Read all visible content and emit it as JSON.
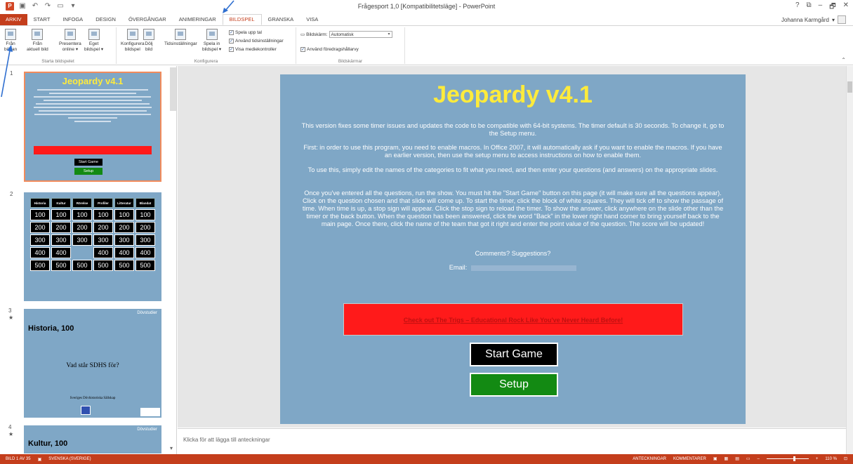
{
  "app": {
    "title": "Frågesport 1,0 [Kompatibilitetsläge] - PowerPoint",
    "user": "Johanna Karmgård",
    "win_help": "?",
    "win_restore": "⧉",
    "win_min": "–",
    "win_max": "🗗",
    "win_close": "✕"
  },
  "tabs": [
    "ARKIV",
    "START",
    "INFOGA",
    "DESIGN",
    "ÖVERGÅNGAR",
    "ANIMERINGAR",
    "BILDSPEL",
    "GRANSKA",
    "VISA"
  ],
  "ribbon": {
    "g1": {
      "label": "Starta bildspelet",
      "btns": [
        {
          "l1": "Från",
          "l2": "början"
        },
        {
          "l1": "Från",
          "l2": "aktuell bild"
        },
        {
          "l1": "Presentera",
          "l2": "online ▾"
        },
        {
          "l1": "Eget",
          "l2": "bildspel ▾"
        }
      ]
    },
    "g2": {
      "label": "Konfigurera",
      "btns": [
        {
          "l1": "Konfigurera",
          "l2": "bildspel"
        },
        {
          "l1": "Dölj",
          "l2": "bild"
        },
        {
          "l1": "Tidsinställningar",
          "l2": ""
        },
        {
          "l1": "Spela in",
          "l2": "bildspel ▾"
        }
      ],
      "checks": [
        "Spela upp tal",
        "Använd tidsinställningar",
        "Visa mediekontroller"
      ]
    },
    "g3": {
      "label": "Bildskärmar",
      "monitor_label": "Bildskärm:",
      "monitor_value": "Automatisk",
      "presenter_label": "Använd föredragshållarvy"
    }
  },
  "thumbs": {
    "nums": [
      "1",
      "2",
      "3",
      "4"
    ],
    "s1": {
      "title": "Jeopardy v4.1",
      "start": "Start Game",
      "setup": "Setup"
    },
    "s2": {
      "categories": [
        "Historia",
        "Kultur",
        "Rörelse",
        "Profiler",
        "Litteratur",
        "Blandat"
      ],
      "rows": [
        [
          "100",
          "100",
          "100",
          "100",
          "100",
          "100"
        ],
        [
          "200",
          "200",
          "200",
          "200",
          "200",
          "200"
        ],
        [
          "300",
          "300",
          "300",
          "300",
          "300",
          "300"
        ],
        [
          "400",
          "400",
          "",
          "400",
          "400",
          "400"
        ],
        [
          "500",
          "500",
          "500",
          "500",
          "500",
          "500"
        ]
      ]
    },
    "s3": {
      "heading": "Historia, 100",
      "logo": "Dövstudier",
      "question": "Vad står SDHS för?",
      "org": "Sveriges Dövhistoriska Sällskap"
    },
    "s4": {
      "heading": "Kultur, 100",
      "logo": "Dövstudier"
    }
  },
  "slide": {
    "title": "Jeopardy v4.1",
    "p1": "This version fixes some timer issues and updates the code to be compatible with 64-bit systems. The timer default is 30 seconds. To change it, go to the Setup menu.",
    "p2": "First: in order to use this program, you need to enable macros. In Office 2007, it will automatically ask if you want to enable the macros. If you have an earlier version, then use the setup menu to access instructions on how to enable them.",
    "p3": "To use this, simply edit the names of the categories to fit what you need, and then enter your questions (and answers) on the appropriate slides.",
    "p4": "Once you've entered all the questions, run the show. You must hit the \"Start Game\" button on this page (it will make sure all the questions appear). Click on the question chosen and that slide will come up. To start the timer, click the block of white squares. They will tick off to show the passage of time. When time is up, a stop sign will appear. Click the stop sign to reload the timer. To show the answer, click anywhere on the slide other than the timer or the back button. When the question has been answered, click the word \"Back\" in the lower right hand corner to bring yourself back to the main page. Once there, click the name of the team that got it right and enter the point value of the question. The score will be updated!",
    "p5": "Comments? Suggestions?",
    "p6": "Email:",
    "link": "Check out The Trigs – Educational Rock Like You've Never Heard Before!",
    "start": "Start Game",
    "setup": "Setup"
  },
  "notes": "Klicka för att lägga till anteckningar",
  "status": {
    "slide": "BILD 1 AV 35",
    "lang": "SVENSKA (SVERIGE)",
    "notes": "ANTECKNINGAR",
    "comments": "KOMMENTARER",
    "zoom": "110 %"
  },
  "colors": {
    "accent": "#c43e1c",
    "slide_bg": "#7fa7c6",
    "title_yellow": "#ffeb3b",
    "arrow": "#2f6fd0"
  }
}
